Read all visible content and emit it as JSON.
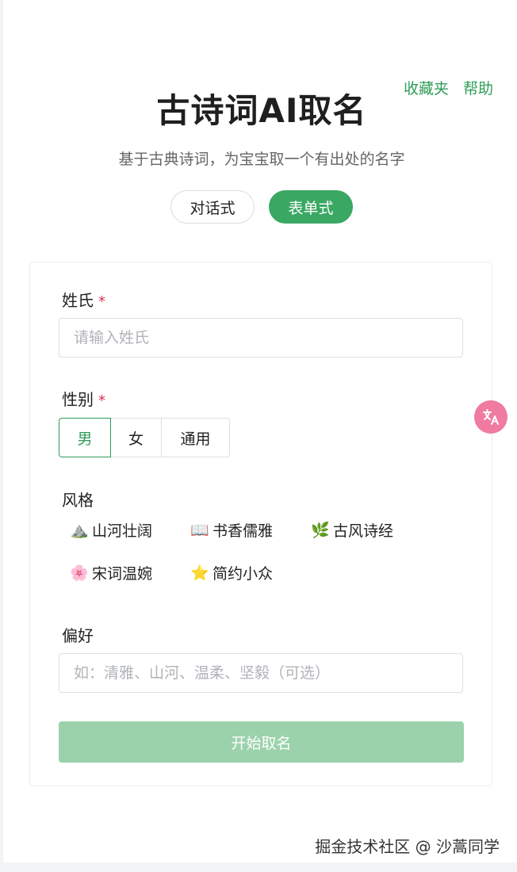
{
  "header": {
    "links": [
      {
        "label": "收藏夹"
      },
      {
        "label": "帮助"
      }
    ],
    "title": "古诗词AI取名",
    "subtitle": "基于古典诗词，为宝宝取一个有出处的名字"
  },
  "mode_switch": {
    "options": [
      {
        "label": "对话式",
        "active": false
      },
      {
        "label": "表单式",
        "active": true
      }
    ]
  },
  "form": {
    "surname": {
      "label": "姓氏",
      "required_mark": "*",
      "value": "",
      "placeholder": "请输入姓氏"
    },
    "gender": {
      "label": "性别",
      "required_mark": "*",
      "options": [
        {
          "label": "男",
          "selected": true
        },
        {
          "label": "女",
          "selected": false
        },
        {
          "label": "通用",
          "selected": false
        }
      ]
    },
    "style": {
      "label": "风格",
      "options": [
        {
          "icon": "⛰️",
          "label": "山河壮阔"
        },
        {
          "icon": "📖",
          "label": "书香儒雅"
        },
        {
          "icon": "🌿",
          "label": "古风诗经"
        },
        {
          "icon": "🌸",
          "label": "宋词温婉"
        },
        {
          "icon": "⭐",
          "label": "简约小众"
        }
      ]
    },
    "preference": {
      "label": "偏好",
      "value": "",
      "placeholder": "如：清雅、山河、温柔、坚毅（可选）"
    },
    "submit_label": "开始取名"
  },
  "watermark": "掘金技术社区 @ 沙蒿同学",
  "colors": {
    "accent": "#3aa863",
    "accent_text": "#2f9d5a",
    "submit_disabled": "#9bd2ab",
    "required": "#d9304d",
    "translate_button": "#f07aa0"
  }
}
